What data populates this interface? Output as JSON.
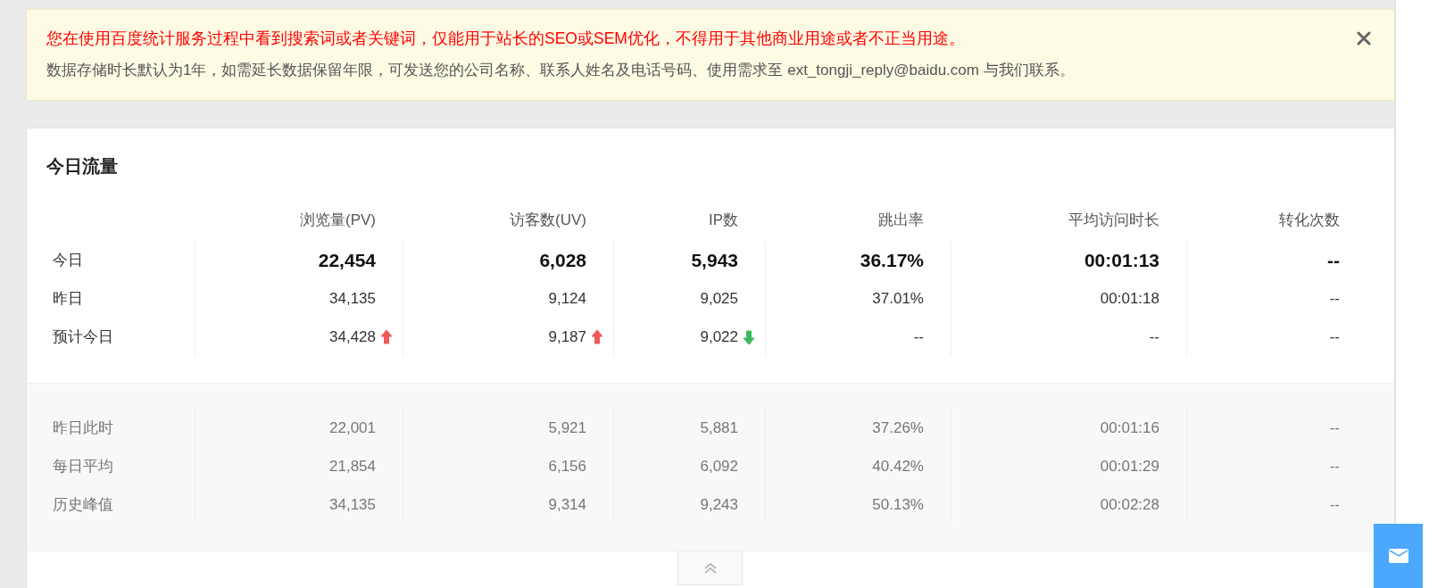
{
  "notice": {
    "warning": "您在使用百度统计服务过程中看到搜索词或者关键词，仅能用于站长的SEO或SEM优化，不得用于其他商业用途或者不正当用途。",
    "info": "数据存储时长默认为1年，如需延长数据保留年限，可发送您的公司名称、联系人姓名及电话号码、使用需求至 ext_tongji_reply@baidu.com 与我们联系。",
    "dismissible": true
  },
  "card": {
    "title": "今日流量",
    "columns": [
      "浏览量(PV)",
      "访客数(UV)",
      "IP数",
      "跳出率",
      "平均访问时长",
      "转化次数"
    ],
    "rows": [
      {
        "label": "今日",
        "kind": "headline",
        "cells": [
          {
            "text": "22,454",
            "kind": "plain"
          },
          {
            "text": "6,028",
            "kind": "plain"
          },
          {
            "text": "5,943",
            "kind": "plain"
          },
          {
            "text": "36.17%",
            "kind": "plain"
          },
          {
            "text": "00:01:13",
            "kind": "plain"
          },
          {
            "text": "--",
            "kind": "plain"
          }
        ]
      },
      {
        "label": "昨日",
        "kind": "plain",
        "cells": [
          {
            "text": "34,135",
            "kind": "plain"
          },
          {
            "text": "9,124",
            "kind": "plain"
          },
          {
            "text": "9,025",
            "kind": "plain"
          },
          {
            "text": "37.01%",
            "kind": "plain"
          },
          {
            "text": "00:01:18",
            "kind": "plain"
          },
          {
            "text": "--",
            "kind": "plain"
          }
        ]
      },
      {
        "label": "预计今日",
        "kind": "plain",
        "cells": [
          {
            "text": "34,428",
            "kind": "rise"
          },
          {
            "text": "9,187",
            "kind": "rise"
          },
          {
            "text": "9,022",
            "kind": "fall"
          },
          {
            "text": "--",
            "kind": "plain"
          },
          {
            "text": "--",
            "kind": "plain"
          },
          {
            "text": "--",
            "kind": "plain"
          }
        ]
      }
    ],
    "history_rows": [
      {
        "label": "昨日此时",
        "cells": [
          "22,001",
          "5,921",
          "5,881",
          "37.26%",
          "00:01:16",
          "--"
        ]
      },
      {
        "label": "每日平均",
        "cells": [
          "21,854",
          "6,156",
          "6,092",
          "40.42%",
          "00:01:29",
          "--"
        ]
      },
      {
        "label": "历史峰值",
        "cells": [
          "34,135",
          "9,314",
          "9,243",
          "50.13%",
          "00:02:28",
          "--"
        ]
      }
    ]
  }
}
